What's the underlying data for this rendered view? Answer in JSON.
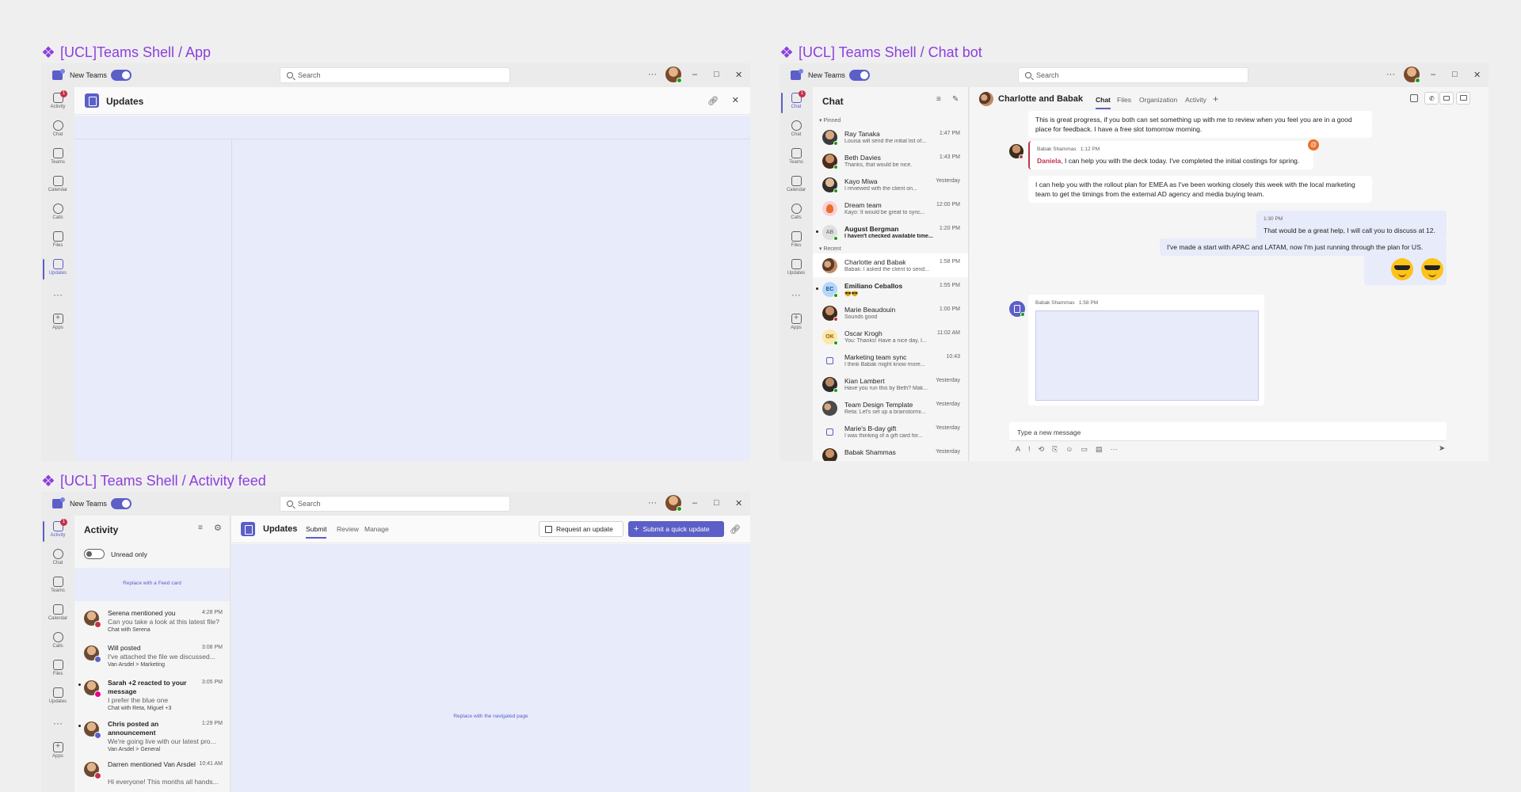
{
  "frames": {
    "app": "[UCL]Teams Shell / App",
    "chatbot": "[UCL] Teams Shell / Chat bot",
    "activity": "[UCL] Teams Shell / Activity feed"
  },
  "titlebar": {
    "new_teams": "New Teams",
    "search_placeholder": "Search",
    "more": "···",
    "minimize": "–",
    "maximize": "□",
    "close": "✕"
  },
  "rail": {
    "activity": "Activity",
    "chat": "Chat",
    "teams": "Teams",
    "calendar": "Calendar",
    "calls": "Calls",
    "files": "Files",
    "updates": "Updates",
    "more": "···",
    "apps": "Apps",
    "badge": "1"
  },
  "app_window": {
    "title": "Updates"
  },
  "chat_window": {
    "list_title": "Chat",
    "pinned_label": "Pinned",
    "recent_label": "Recent",
    "pinned": [
      {
        "name": "Ray Tanaka",
        "preview": "Louisa will send the initial list of...",
        "time": "1:47 PM"
      },
      {
        "name": "Beth Davies",
        "preview": "Thanks, that would be nice.",
        "time": "1:43 PM"
      },
      {
        "name": "Kayo Miwa",
        "preview": "I reviewed with the client on...",
        "time": "Yesterday"
      },
      {
        "name": "Dream team",
        "preview": "Kayo: It would be great to sync...",
        "time": "12:00 PM"
      },
      {
        "name": "August Bergman",
        "preview": "I haven't checked available time...",
        "time": "1:20 PM",
        "initials": "AB"
      }
    ],
    "recent": [
      {
        "name": "Charlotte and Babak",
        "preview": "Babak: I asked the client to send...",
        "time": "1:58 PM"
      },
      {
        "name": "Emiliano Ceballos",
        "preview": "😎😎",
        "time": "1:55 PM",
        "initials": "EC"
      },
      {
        "name": "Marie Beaudouin",
        "preview": "Sounds good",
        "time": "1:00 PM"
      },
      {
        "name": "Oscar Krogh",
        "preview": "You: Thanks! Have a nice day, I...",
        "time": "11:02 AM",
        "initials": "OK"
      },
      {
        "name": "Marketing team sync",
        "preview": "I think Babak might know more...",
        "time": "10:43"
      },
      {
        "name": "Kian Lambert",
        "preview": "Have you run this by Beth? Mak...",
        "time": "Yesterday"
      },
      {
        "name": "Team Design Template",
        "preview": "Reta: Let's set up a brainstormi...",
        "time": "Yesterday"
      },
      {
        "name": "Marie's B-day gift",
        "preview": "I was thinking of a gift card for...",
        "time": "Yesterday"
      },
      {
        "name": "Babak Shammas",
        "preview": "",
        "time": "Yesterday"
      }
    ],
    "conversation_title": "Charlotte and Babak",
    "tabs": [
      "Chat",
      "Files",
      "Organization",
      "Activity"
    ],
    "add_tab": "+",
    "messages": {
      "m1": "This is great progress, if you both can set something up with me to review when you feel you are in a good place for feedback. I have a free slot tomorrow morning.",
      "m2_sender": "Babak Shammas",
      "m2_time": "1:12 PM",
      "m2_mention": "Daniela",
      "m2_text": ", I can help you with the deck today. I've completed the initial costings for spring.",
      "m3": "I can help you with the rollout plan for EMEA as I've been working closely this week with the local marketing team to get the timings from the external AD agency and media buying team.",
      "m4_time": "1:30 PM",
      "m4_text": "That would be a great help, I will call you to discuss at 12.",
      "m5": "I've made a start with APAC and LATAM, now I'm just running through the plan for US.",
      "m6_sender": "Babak Shammas",
      "m6_time": "1:58 PM"
    },
    "compose_placeholder": "Type a new message",
    "compose_more": "···"
  },
  "activity_window": {
    "title": "Activity",
    "unread_only": "Unread only",
    "feed_card_placeholder": "Replace with a Feed card",
    "feed": [
      {
        "title": "Serena mentioned you",
        "body": "Can you take a look at this latest file?",
        "context": "Chat with Serena",
        "time": "4:28 PM"
      },
      {
        "title": "Will posted",
        "body": "I've attached the file we discussed...",
        "context": "Van Arsdel > Marketing",
        "time": "3:08 PM"
      },
      {
        "title": "Sarah +2 reacted to your message",
        "body": "I prefer the blue one",
        "context": "Chat with Reta, Miguel +3",
        "time": "3:05 PM"
      },
      {
        "title": "Chris posted an announcement",
        "body": "We're going live with our latest pro...",
        "context": "Van Arsdel > General",
        "time": "1:29 PM"
      },
      {
        "title": "Darren mentioned Van Arsdel",
        "body": "Hi everyone! This months all hands...",
        "context": "",
        "time": "10:41 AM"
      }
    ],
    "app_title": "Updates",
    "tabs": [
      "Submit",
      "Review",
      "Manage"
    ],
    "request_button": "Request an update",
    "submit_button": "Submit a quick update",
    "page_placeholder": "Replace with the navigated page"
  }
}
